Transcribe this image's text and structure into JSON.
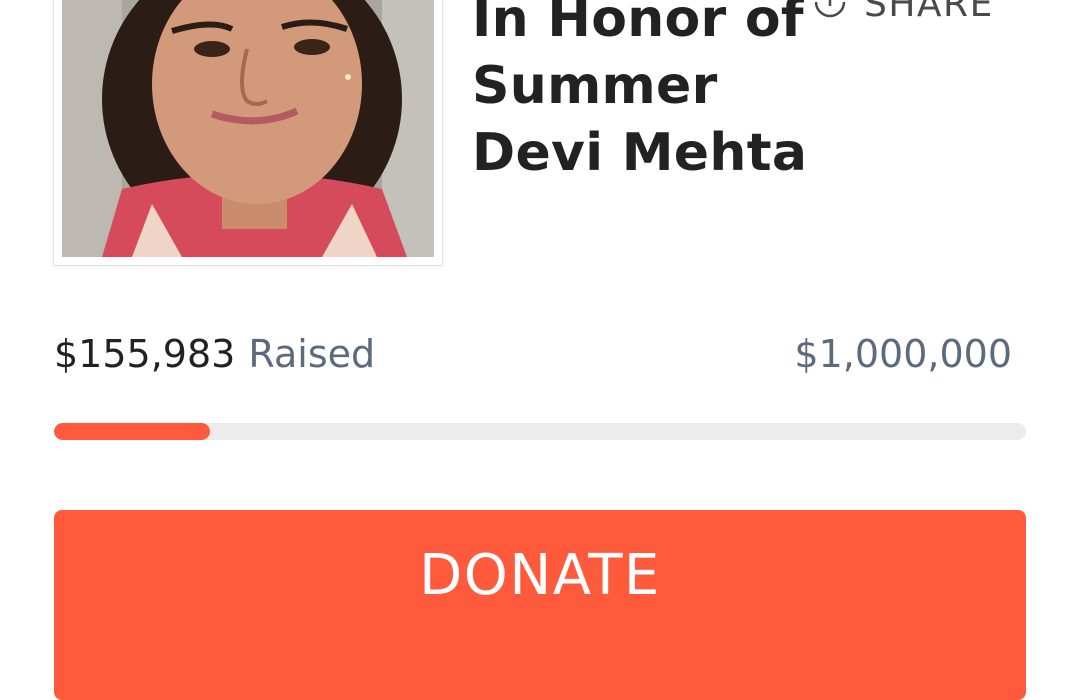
{
  "campaign": {
    "title": "In Honor of Summer Devi Mehta"
  },
  "share": {
    "label": "SHARE",
    "icon": "share-upload-icon"
  },
  "fundraising": {
    "raised_amount": "$155,983",
    "raised_label": "Raised",
    "goal_amount": "$1,000,000",
    "progress_fraction": 0.16
  },
  "donate": {
    "label": "DONATE"
  },
  "colors": {
    "accent": "#ff5a3c",
    "track": "#ececec",
    "muted_text": "#5b6b7d",
    "primary_text": "#222222"
  }
}
